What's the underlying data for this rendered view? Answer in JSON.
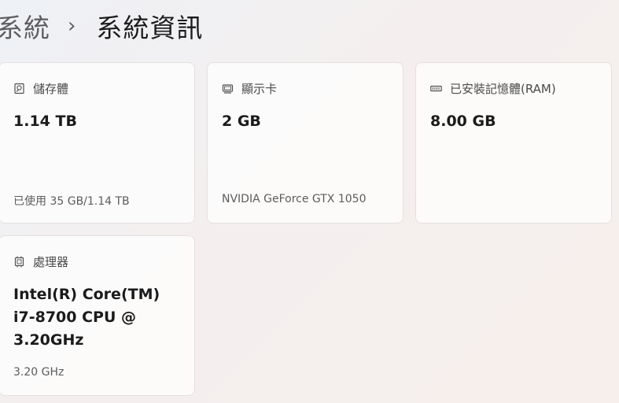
{
  "breadcrumb": {
    "parent": "系統",
    "separator": "›",
    "current": "系統資訊"
  },
  "cards": [
    {
      "title": "儲存體",
      "icon": "storage-icon",
      "value": "1.14 TB",
      "sub": "已使用 35 GB/1.14 TB"
    },
    {
      "title": "顯示卡",
      "icon": "display-adapter-icon",
      "value": "2 GB",
      "sub": "NVIDIA GeForce GTX 1050"
    },
    {
      "title": "已安裝記憶體(RAM)",
      "icon": "memory-icon",
      "value": "8.00 GB",
      "sub": ""
    },
    {
      "title": "處理器",
      "icon": "processor-icon",
      "value_lines": [
        "Intel(R) Core(TM)",
        "i7-8700 CPU @",
        "3.20GHz"
      ],
      "sub": "3.20 GHz"
    }
  ],
  "colors": {
    "card_background": "#ffffff",
    "card_border": "#e5e0df",
    "text_primary": "#1b1b1b",
    "text_secondary": "#5c5c5c"
  }
}
